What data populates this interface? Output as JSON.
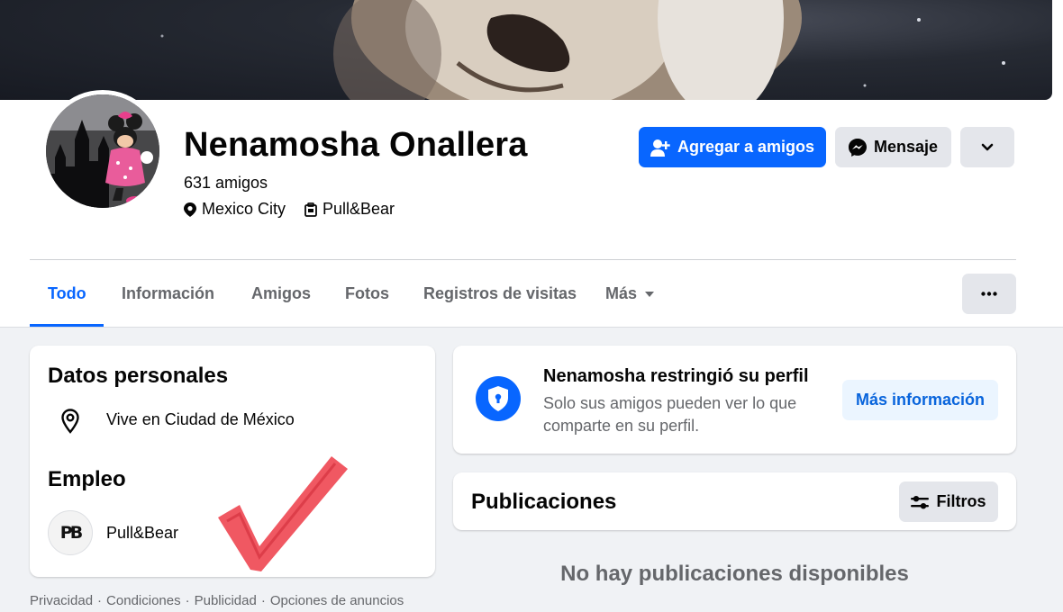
{
  "profile": {
    "name": "Nenamosha Onallera",
    "friends": "631 amigos",
    "location": "Mexico City",
    "workplace": "Pull&Bear"
  },
  "actions": {
    "add_friend": "Agregar a amigos",
    "message": "Mensaje"
  },
  "tabs": [
    {
      "label": "Todo",
      "active": true
    },
    {
      "label": "Información",
      "active": false
    },
    {
      "label": "Amigos",
      "active": false
    },
    {
      "label": "Fotos",
      "active": false
    },
    {
      "label": "Registros de visitas",
      "active": false
    },
    {
      "label": "Más",
      "active": false
    }
  ],
  "intro": {
    "title": "Datos personales",
    "lives_in": "Vive en Ciudad de México",
    "work_title": "Empleo",
    "employer": "Pull&Bear",
    "employer_logo_text": "PB"
  },
  "footer": {
    "links": [
      "Privacidad",
      "Condiciones",
      "Publicidad",
      "Opciones de anuncios"
    ],
    "separator": "·"
  },
  "restricted": {
    "title": "Nenamosha restringió su perfil",
    "subtitle": "Solo sus amigos pueden ver lo que comparte en su perfil.",
    "button": "Más información"
  },
  "posts": {
    "title": "Publicaciones",
    "filter_button": "Filtros",
    "empty_text": "No hay publicaciones disponibles"
  },
  "colors": {
    "primary": "#0866ff",
    "secondary_button": "#e4e6eb",
    "page_background": "#f0f2f5",
    "checkmark": "#ef4a55"
  },
  "icons": [
    "location-pin-icon",
    "briefcase-icon",
    "add-friend-icon",
    "messenger-icon",
    "chevron-down-icon",
    "more-dots-icon",
    "shield-lock-icon",
    "filters-icon",
    "caret-down-icon"
  ]
}
